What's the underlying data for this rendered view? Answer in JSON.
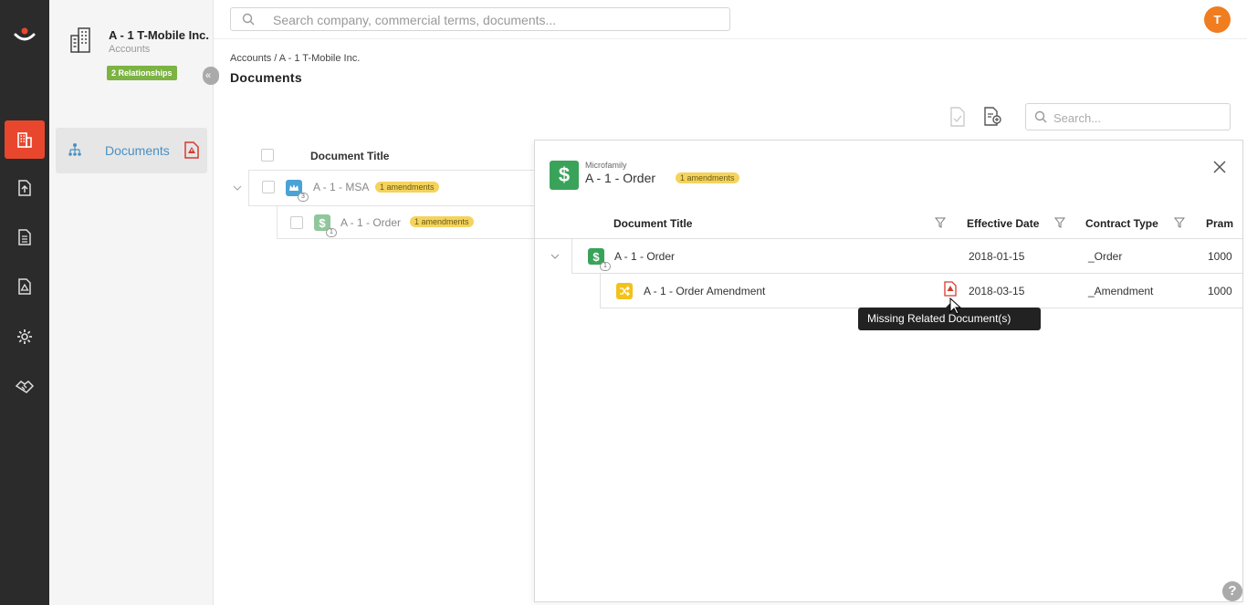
{
  "account": {
    "name": "A - 1 T-Mobile Inc.",
    "category": "Accounts",
    "relationships_badge": "2 Relationships",
    "collapse_glyph": "«"
  },
  "sidebar": {
    "documents_label": "Documents"
  },
  "topbar": {
    "search_placeholder": "Search company, commercial terms, documents...",
    "avatar_initial": "T"
  },
  "breadcrumb": "Accounts / A - 1 T-Mobile Inc.",
  "page_title": "Documents",
  "right_search_placeholder": "Search...",
  "bg_table": {
    "header": "Document Title",
    "rows": [
      {
        "title": "A - 1 - MSA",
        "badge": "1 amendments",
        "count": "3",
        "icon": "crown-icon"
      },
      {
        "title": "A - 1 - Order",
        "badge": "1 amendments",
        "count": "1",
        "icon": "dollar-icon"
      }
    ]
  },
  "modal": {
    "kind": "Microfamily",
    "title": "A - 1 - Order",
    "badge": "1 amendments",
    "icon_glyph": "$",
    "columns": [
      "Document Title",
      "Effective Date",
      "Contract Type",
      "Pram"
    ],
    "rows": [
      {
        "title": "A - 1 - Order",
        "count": "1",
        "date": "2018-01-15",
        "type": "_Order",
        "amount": "1000",
        "icon": "dollar-icon",
        "glyph": "$"
      },
      {
        "title": "A - 1 - Order Amendment",
        "date": "2018-03-15",
        "type": "_Amendment",
        "amount": "1000",
        "icon": "shuffle-icon"
      }
    ]
  },
  "tooltip": "Missing Related Document(s)",
  "help_glyph": "?",
  "colors": {
    "rail": "#2b2b2b",
    "accent_red": "#e8472d",
    "green": "#3aa35a",
    "badge_yellow": "#f4d35e",
    "relationships_green": "#7cb342",
    "avatar_orange": "#f07d1f",
    "link_blue": "#4a90c2"
  }
}
